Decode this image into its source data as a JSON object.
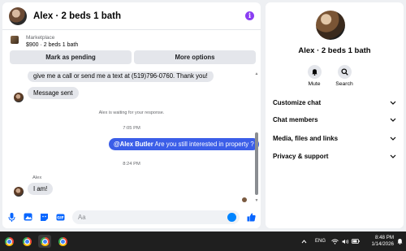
{
  "chat": {
    "title": "Alex · 2 beds 1 bath",
    "listing": {
      "label": "Marketplace",
      "price_title": "$900 · 2 beds 1 bath"
    },
    "buttons": {
      "pending": "Mark as pending",
      "more": "More options"
    },
    "messages": {
      "incoming_1": "give me a call or send me a text at (519)796-0760. Thank you!",
      "incoming_2": "Message sent",
      "system": "Alex is waiting for your response.",
      "time_1": "7:05 PM",
      "outgoing_mention": "@Alex Butler",
      "outgoing_text": " Are you still interested in property ?",
      "time_2": "8:24 PM",
      "sender": "Alex",
      "incoming_3": "I am!"
    },
    "composer": {
      "placeholder": "Aa"
    }
  },
  "side": {
    "name": "Alex · 2 beds 1 bath",
    "actions": {
      "mute": "Mute",
      "search": "Search"
    },
    "menu": [
      "Customize chat",
      "Chat members",
      "Media, files and links",
      "Privacy & support"
    ]
  },
  "taskbar": {
    "lang": "ENG",
    "time": "8:48 PM",
    "date": "1/14/2026"
  },
  "colors": {
    "accent": "#3b5ee8",
    "info": "#8a3df2",
    "like": "#0084ff"
  },
  "icons": [
    "info-icon",
    "microphone-icon",
    "image-icon",
    "sticker-icon",
    "gif-icon",
    "emoji-icon",
    "thumbs-up-icon",
    "bell-icon",
    "search-icon",
    "chevron-down-icon",
    "chrome-icon",
    "wifi-icon",
    "speaker-icon",
    "battery-icon",
    "notification-bell-icon"
  ]
}
